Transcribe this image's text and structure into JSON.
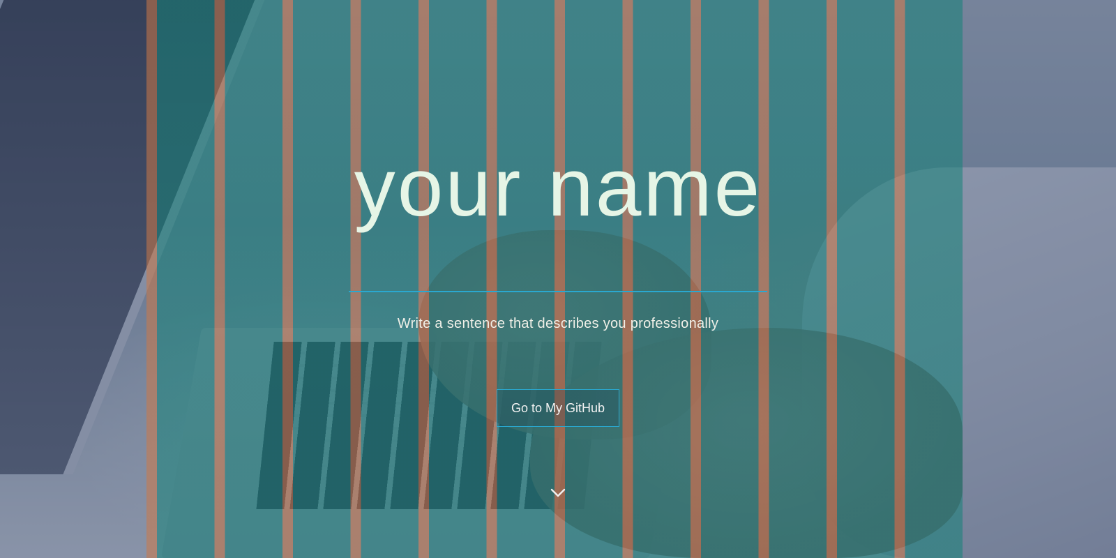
{
  "hero": {
    "name": "your name",
    "tagline": "Write a sentence that describes you professionally",
    "button_label": "Go to My GitHub"
  },
  "icons": {
    "scroll": "chevron-down-icon"
  },
  "colors": {
    "accent": "#2aa8d0",
    "name_text": "#e6f5e6",
    "stripe_orange": "#cd7846",
    "stripe_teal": "#148278"
  }
}
